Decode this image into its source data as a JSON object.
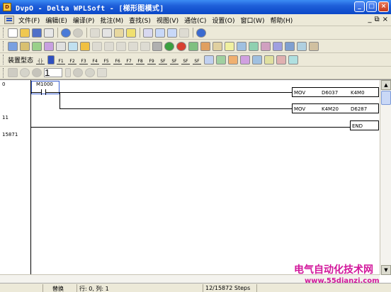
{
  "window": {
    "title": "DvpO - Delta WPLSoft - [梯形图模式]",
    "app_icon_text": "D",
    "buttons": [
      "_",
      "□",
      "×"
    ]
  },
  "menu": {
    "items": [
      "文件(F)",
      "编辑(E)",
      "编译(P)",
      "批注(M)",
      "查找(S)",
      "视图(V)",
      "通信(C)",
      "设置(O)",
      "窗口(W)",
      "帮助(H)"
    ],
    "right_controls": [
      "_",
      "⧉",
      "×"
    ]
  },
  "toolbar3": {
    "mode_label": "装置型态"
  },
  "toolbar4": {
    "step_value": "1"
  },
  "ladder": {
    "rows": [
      "0",
      "11",
      "15871"
    ],
    "contact": {
      "label": "M1000"
    },
    "instructions": [
      {
        "op": "MOV",
        "arg1": "D6037",
        "arg2": "K4M0"
      },
      {
        "op": "MOV",
        "arg1": "K4M20",
        "arg2": "D6287"
      },
      {
        "op": "END",
        "arg1": "",
        "arg2": ""
      }
    ]
  },
  "watermark": {
    "line1": "电气自动化技术网",
    "line2": "www.55dianzi.com"
  },
  "status": {
    "mode": "替换",
    "position": "行: 0, 列: 1",
    "steps": "12/15872 Steps"
  },
  "colors": {
    "titlebar": "#0a47c7",
    "watermark": "#d2179b",
    "cursor_box": "#3a5fd0"
  }
}
